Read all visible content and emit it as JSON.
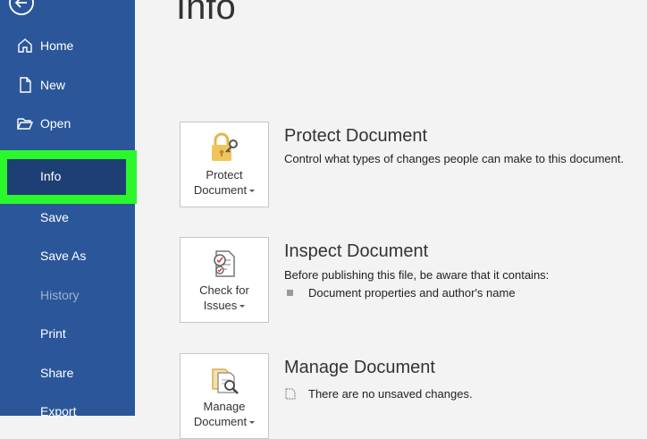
{
  "sidebar": {
    "items": [
      {
        "label": "Home",
        "icon": "home-icon"
      },
      {
        "label": "New",
        "icon": "new-document-icon"
      },
      {
        "label": "Open",
        "icon": "open-folder-icon"
      },
      {
        "label": "Info",
        "selected": true
      },
      {
        "label": "Save"
      },
      {
        "label": "Save As"
      },
      {
        "label": "History",
        "disabled": true
      },
      {
        "label": "Print"
      },
      {
        "label": "Share"
      },
      {
        "label": "Export"
      }
    ],
    "background": "#2b579a",
    "highlight_color": "#2cf72c"
  },
  "main": {
    "title": "Info",
    "sections": [
      {
        "button_line1": "Protect",
        "button_line2": "Document",
        "icon": "lock-key-icon",
        "title": "Protect Document",
        "description": "Control what types of changes people can make to this document."
      },
      {
        "button_line1": "Check for",
        "button_line2": "Issues",
        "icon": "inspect-document-icon",
        "title": "Inspect Document",
        "description": "Before publishing this file, be aware that it contains:",
        "bullet": "Document properties and author's name"
      },
      {
        "button_line1": "Manage",
        "button_line2": "Document",
        "icon": "manage-document-icon",
        "title": "Manage Document",
        "status": "There are no unsaved changes."
      }
    ]
  }
}
